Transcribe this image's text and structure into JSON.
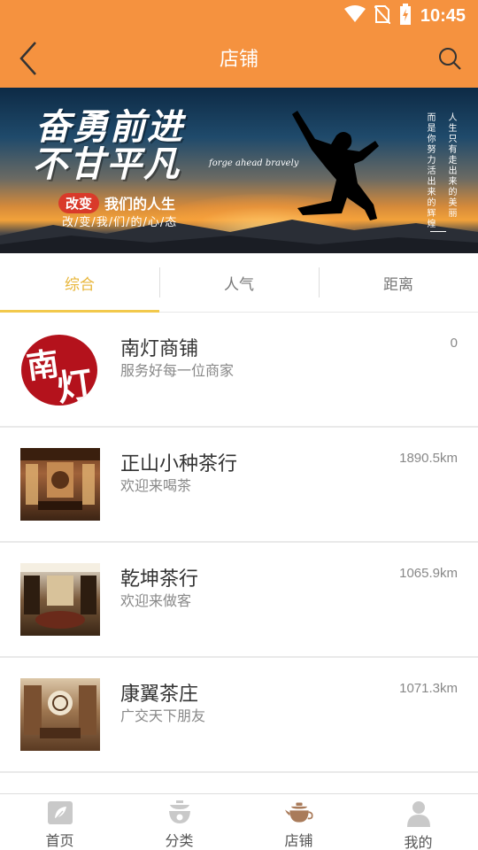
{
  "status_bar": {
    "time": "10:45"
  },
  "header": {
    "title": "店铺"
  },
  "banner": {
    "headline_line1": "奋勇前进",
    "headline_line2": "不甘平凡",
    "english": "forge ahead bravely",
    "sub_pill": "改变",
    "sub_rest": "我们的人生",
    "sub2": "改/变/我/们/的/心/态",
    "vertical_1": "而是你努力活出来的辉煌",
    "vertical_2": "人生只有走出来的美丽"
  },
  "tabs": [
    {
      "label": "综合",
      "active": true
    },
    {
      "label": "人气",
      "active": false
    },
    {
      "label": "距离",
      "active": false
    }
  ],
  "shops": [
    {
      "name": "南灯商铺",
      "desc": "服务好每一位商家",
      "distance": "0",
      "logo_text_1": "南",
      "logo_text_2": "灯"
    },
    {
      "name": "正山小种茶行",
      "desc": "欢迎来喝茶",
      "distance": "1890.5km"
    },
    {
      "name": "乾坤茶行",
      "desc": "欢迎来做客",
      "distance": "1065.9km"
    },
    {
      "name": "康翼茶庄",
      "desc": "广交天下朋友",
      "distance": "1071.3km"
    }
  ],
  "bottom_nav": [
    {
      "label": "首页",
      "icon": "home-icon"
    },
    {
      "label": "分类",
      "icon": "category-icon"
    },
    {
      "label": "店铺",
      "icon": "teapot-icon",
      "active": true
    },
    {
      "label": "我的",
      "icon": "user-icon"
    }
  ],
  "colors": {
    "primary": "#f5923f",
    "tab_active": "#f2c94c",
    "nav_active_icon": "#a97b5a",
    "nav_inactive_icon": "#c9c9c9"
  }
}
